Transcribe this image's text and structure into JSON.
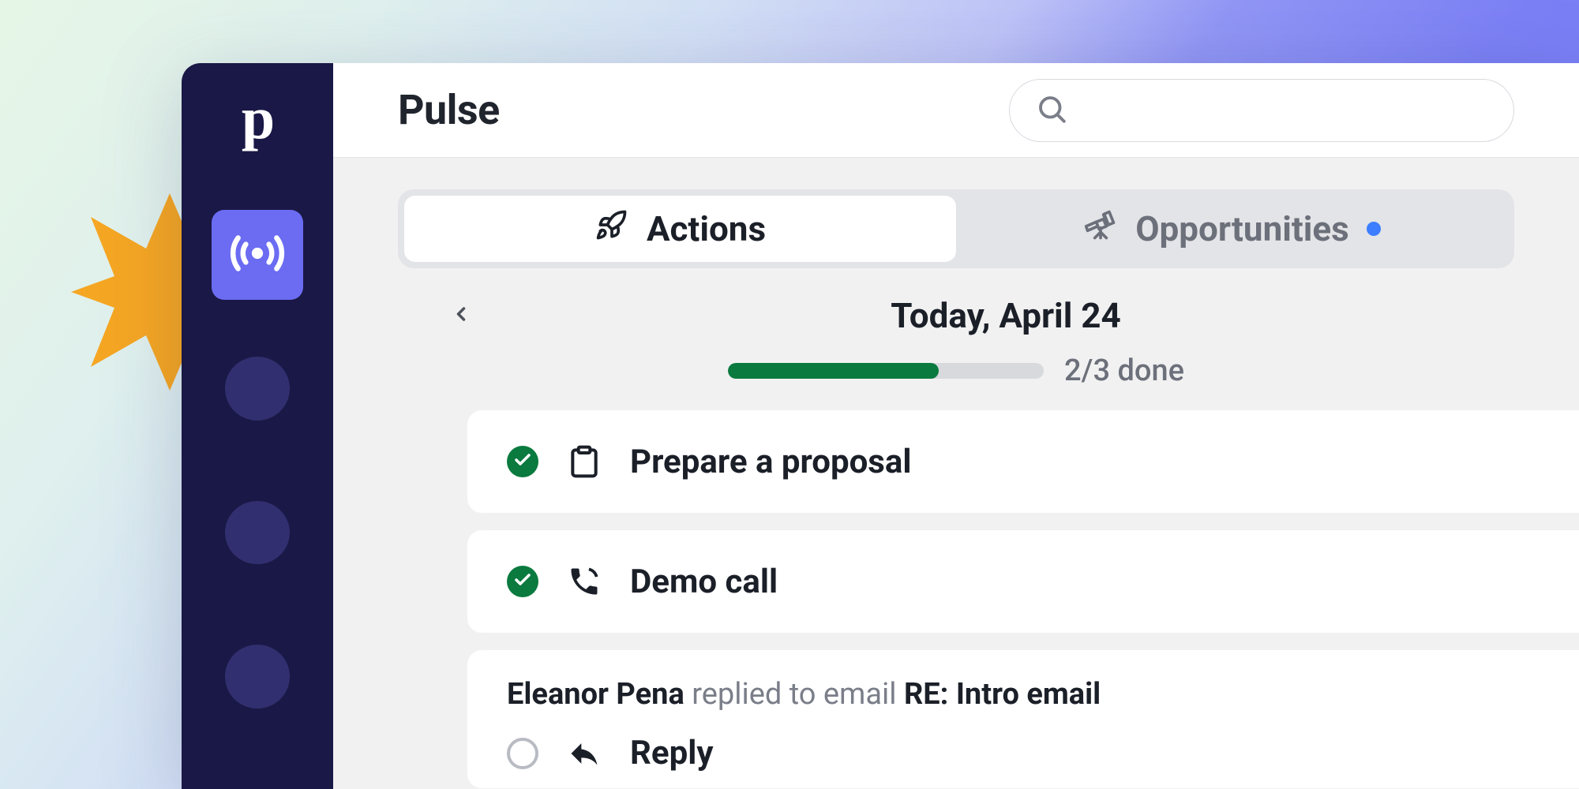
{
  "sidebar": {
    "logo_glyph": "p"
  },
  "header": {
    "title": "Pulse"
  },
  "tabs": {
    "actions_label": "Actions",
    "opportunities_label": "Opportunities"
  },
  "date": {
    "label": "Today, April 24"
  },
  "progress": {
    "done": 2,
    "total": 3,
    "text": "2/3 done",
    "percent": 66.7
  },
  "tasks": [
    {
      "title": "Prepare a proposal",
      "done": true,
      "icon": "clipboard"
    },
    {
      "title": "Demo call",
      "done": true,
      "icon": "phone"
    }
  ],
  "email": {
    "sender": "Eleanor Pena",
    "middle_text": " replied to email ",
    "subject": "RE: Intro email",
    "action_label": "Reply",
    "done": false
  }
}
